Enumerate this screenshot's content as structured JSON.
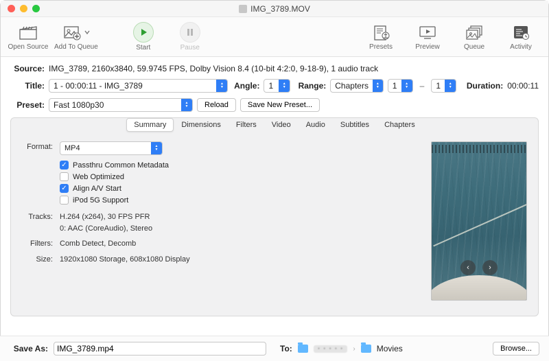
{
  "window": {
    "title": "IMG_3789.MOV"
  },
  "toolbar": {
    "open": "Open Source",
    "queueAdd": "Add To Queue",
    "start": "Start",
    "pause": "Pause",
    "presets": "Presets",
    "preview": "Preview",
    "queue": "Queue",
    "activity": "Activity"
  },
  "source": {
    "label": "Source:",
    "value": "IMG_3789, 2160x3840, 59.9745 FPS, Dolby Vision 8.4 (10-bit 4:2:0, 9-18-9), 1 audio track"
  },
  "title": {
    "label": "Title:",
    "value": "1 - 00:00:11 - IMG_3789"
  },
  "angle": {
    "label": "Angle:",
    "value": "1"
  },
  "range": {
    "label": "Range:",
    "mode": "Chapters",
    "from": "1",
    "to": "1"
  },
  "duration": {
    "label": "Duration:",
    "value": "00:00:11"
  },
  "preset": {
    "label": "Preset:",
    "value": "Fast 1080p30",
    "reload": "Reload",
    "saveNew": "Save New Preset..."
  },
  "tabs": [
    "Summary",
    "Dimensions",
    "Filters",
    "Video",
    "Audio",
    "Subtitles",
    "Chapters"
  ],
  "activeTab": "Summary",
  "summary": {
    "formatLabel": "Format:",
    "format": "MP4",
    "opts": {
      "passthru": {
        "label": "Passthru Common Metadata",
        "checked": true
      },
      "web": {
        "label": "Web Optimized",
        "checked": false
      },
      "align": {
        "label": "Align A/V Start",
        "checked": true
      },
      "ipod": {
        "label": "iPod 5G Support",
        "checked": false
      }
    },
    "tracksLabel": "Tracks:",
    "tracks": "H.264 (x264), 30 FPS PFR\n0: AAC (CoreAudio), Stereo",
    "filtersLabel": "Filters:",
    "filters": "Comb Detect, Decomb",
    "sizeLabel": "Size:",
    "size": "1920x1080 Storage, 608x1080 Display"
  },
  "saveAs": {
    "label": "Save As:",
    "value": "IMG_3789.mp4"
  },
  "dest": {
    "label": "To:",
    "folder": "Movies",
    "browse": "Browse..."
  }
}
